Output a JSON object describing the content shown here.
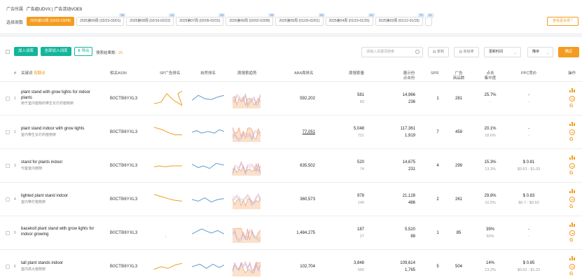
{
  "header": {
    "label": "广告所属",
    "value": "广告组UDVX | 广告活动VOE8"
  },
  "weeks": {
    "label": "选择周数",
    "items": [
      {
        "label": "2025第10周 (03/02-03/08)",
        "badge": "",
        "active": true
      },
      {
        "label": "2025第09周 (02/23-03/01)",
        "badge": "35",
        "active": false
      },
      {
        "label": "2025第08周 (02/16-02/22)",
        "badge": "41",
        "active": false
      },
      {
        "label": "2025第07周 (02/09-02/15)",
        "badge": "53",
        "active": false
      },
      {
        "label": "2025第06周 (02/02-02/08)",
        "badge": "46",
        "active": false
      },
      {
        "label": "2025第05周 (01/26-02/01)",
        "badge": "40",
        "active": false
      },
      {
        "label": "2025第04周 (01/19-01/25)",
        "badge": "10",
        "active": false
      },
      {
        "label": "2025第03周 (01/12-01/18)",
        "badge": "75",
        "active": false
      },
      {
        "label": "",
        "badge": "31",
        "active": false
      }
    ],
    "more": "查看更多周 ^"
  },
  "toolbar": {
    "add_word": "加入词库",
    "add_all": "全部加入词库",
    "export": "⬇ 导出",
    "result_label": "搜索结果数:",
    "result_count": "25",
    "search_placeholder": "请输入关键词搜索",
    "copy": "复制",
    "dedupe": "高级筛",
    "time_select": "更新时间",
    "order_select": "降序",
    "confirm": "确定"
  },
  "columns": {
    "num": "#",
    "keyword": "关键词",
    "sort_tag": "按翻译",
    "asin": "相关ASIN",
    "sp_rank": "SP广告排名",
    "natural_rank": "自然排名",
    "aba_trend": "周搜索趋势",
    "aba_rank": "ABA周排名",
    "weekly_search": "周搜索量",
    "clicks_a": "展示份",
    "clicks_b": "点击份",
    "spr": "SPR",
    "ads_a": "广告",
    "ads_b": "商品数",
    "ctr_a": "点击",
    "ctr_b": "集中度",
    "ppc": "PPC竞价",
    "ops": "操作"
  },
  "rows": [
    {
      "idx": "1",
      "kw": "plant stand with grow lights for indoor plants",
      "cn": "用于室内植物的带生长灯的植物架",
      "asin": "B0CTB6YXL3",
      "aba": "592,202",
      "v1": "581",
      "v2": "83",
      "c1": "14,966",
      "c2": "236",
      "spr": "1",
      "ads": "281",
      "p1": "25.7%",
      "p2": "-",
      "ppc1": "-",
      "ppc2": "-"
    },
    {
      "idx": "2",
      "kw": "plant stand indoor with grow lights",
      "cn": "室内带生长灯的植物架",
      "asin": "B0CTB6YXL3",
      "aba": "77,051",
      "v1": "5,048",
      "v2": "721",
      "c1": "117,361",
      "c2": "1,919",
      "spr": "7",
      "ads": "459",
      "p1": "20.1%",
      "p2": "18.6%",
      "ppc1": "-",
      "ppc2": "-"
    },
    {
      "idx": "3",
      "kw": "stand for plants indoor",
      "cn": "代客室内植物",
      "asin": "B0CTB6YXL3",
      "aba": "635,502",
      "v1": "520",
      "v2": "74",
      "c1": "14,675",
      "c2": "231",
      "spr": "4",
      "ads": "299",
      "p1": "15.3%",
      "p2": "13.3%",
      "ppc1": "$ 0.81",
      "ppc2": "$0.63 - $1.03"
    },
    {
      "idx": "4",
      "kw": "lighted plant stand indoor",
      "cn": "室内带灯植物架",
      "asin": "B0CTB6YXL3",
      "aba": "360,573",
      "v1": "978",
      "v2": "140",
      "c1": "21,128",
      "c2": "486",
      "spr": "2",
      "ads": "261",
      "p1": "29.8%",
      "p2": "10.5%",
      "ppc1": "$ 0.83",
      "ppc2": "$0.7 - $0.93"
    },
    {
      "idx": "5",
      "kw": "bacekoll plant stand with grow lights for indoor growing",
      "cn": "",
      "asin": "B0CTB6YXL3",
      "aba": "1,484,275",
      "v1": "187",
      "v2": "27",
      "c1": "5,520",
      "c2": "88",
      "spr": "1",
      "ads": "85",
      "p1": "39%",
      "p2": "50%",
      "ppc1": "-",
      "ppc2": "-"
    },
    {
      "idx": "6",
      "kw": "tall plant stands indoor",
      "cn": "室内高大植物架",
      "asin": "B0CTB6YXL3",
      "aba": "102,704",
      "v1": "3,848",
      "v2": "550",
      "c1": "109,614",
      "c2": "1,765",
      "spr": "5",
      "ads": "504",
      "p1": "14%",
      "p2": "13.2%",
      "ppc1": "$ 0.85",
      "ppc2": "$0.62 - $1.22"
    }
  ],
  "colors": {
    "orange": "#f39c1f",
    "green": "#13b59b",
    "blue": "#5b9bd5",
    "pink": "#f3a6b6"
  }
}
